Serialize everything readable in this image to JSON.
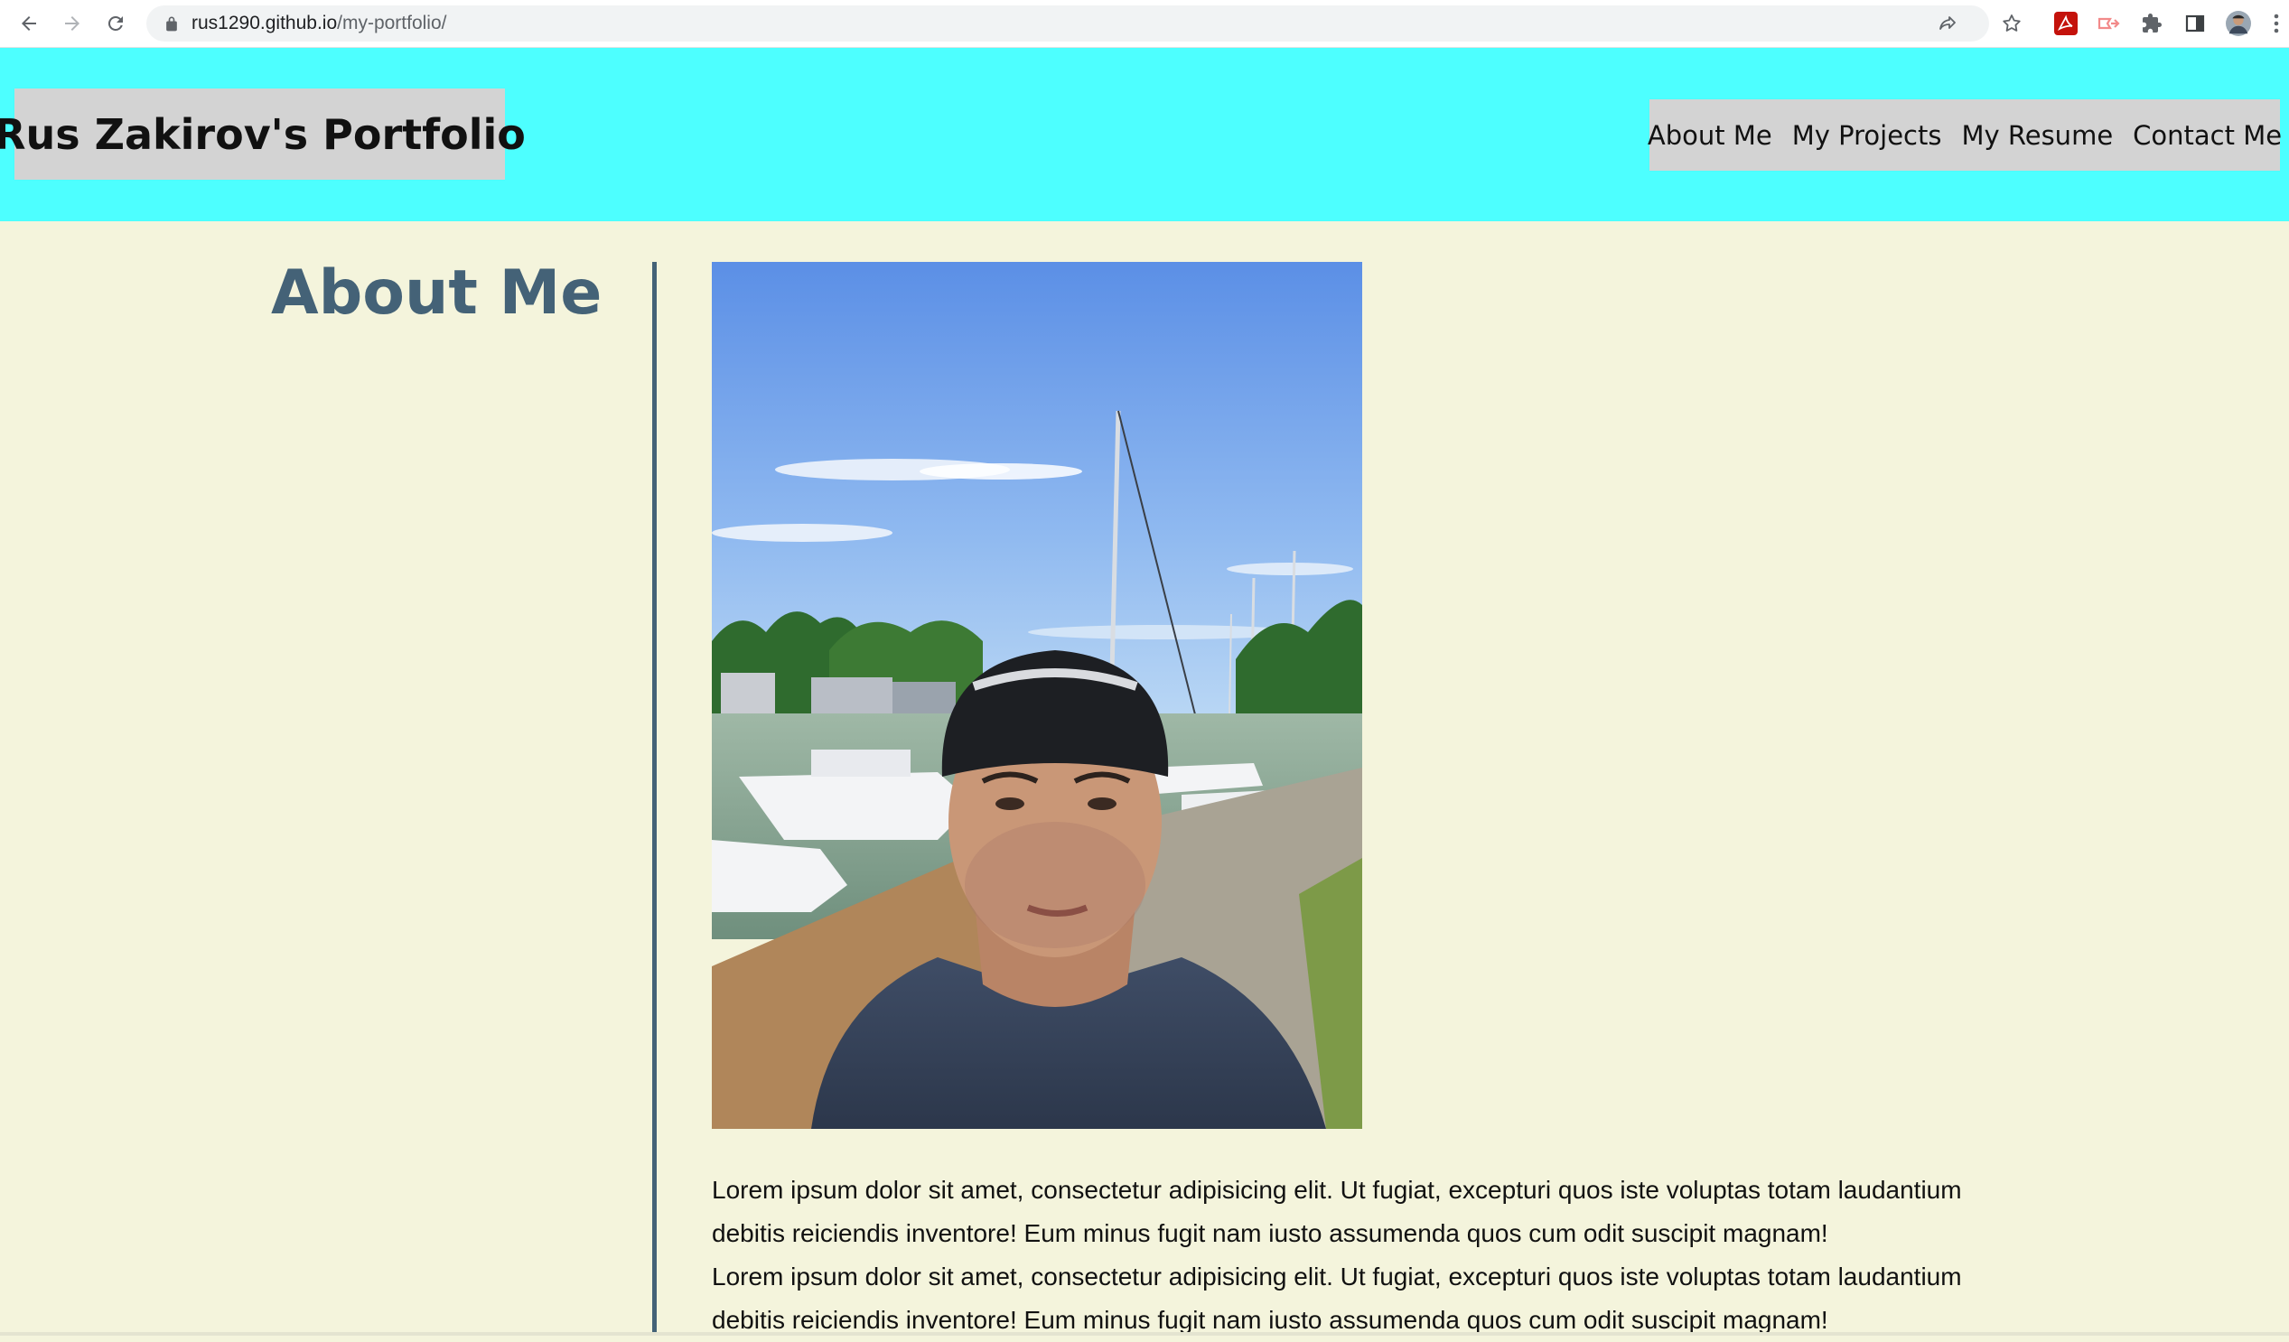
{
  "browser": {
    "url_host": "rus1290.github.io",
    "url_path": "/my-portfolio/",
    "icons": {
      "back": "back-arrow-icon",
      "forward": "forward-arrow-icon",
      "reload": "reload-icon",
      "lock": "lock-icon",
      "share": "share-icon",
      "bookmark": "star-icon",
      "pdf": "acrobat-icon",
      "cast": "cast-icon",
      "extensions": "puzzle-icon",
      "side_panel": "side-panel-icon",
      "profile": "profile-avatar",
      "menu": "kebab-menu-icon"
    }
  },
  "header": {
    "brand": "Rus Zakirov's Portfolio",
    "nav": [
      {
        "label": "About Me"
      },
      {
        "label": "My Projects"
      },
      {
        "label": "My Resume"
      },
      {
        "label": "Contact Me"
      }
    ]
  },
  "about": {
    "title": "About Me",
    "paragraphs": [
      "Lorem ipsum dolor sit amet, consectetur adipisicing elit. Ut fugiat, excepturi quos iste voluptas totam laudantium debitis reiciendis inventore! Eum minus fugit nam iusto assumenda quos cum odit suscipit magnam!",
      "Lorem ipsum dolor sit amet, consectetur adipisicing elit. Ut fugiat, excepturi quos iste voluptas totam laudantium debitis reiciendis inventore! Eum minus fugit nam iusto assumenda quos cum odit suscipit magnam!"
    ]
  },
  "colors": {
    "header_bg": "#4dffff",
    "page_bg": "#f4f4dc",
    "accent": "#446277",
    "nav_bg": "#d3d3d3"
  }
}
